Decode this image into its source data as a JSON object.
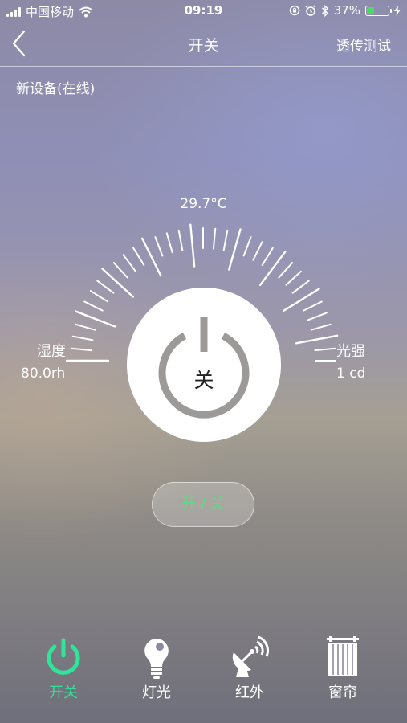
{
  "status_bar": {
    "carrier": "中国移动",
    "time": "09:19",
    "battery_percent": "37%",
    "battery_level": 0.37,
    "icons": [
      "signal-icon",
      "wifi-icon",
      "orientation-lock-icon",
      "alarm-icon",
      "bluetooth-icon",
      "battery-icon",
      "charging-icon"
    ]
  },
  "nav": {
    "back_icon": "chevron-left-icon",
    "title": "开关",
    "right_action": "透传测试"
  },
  "device": {
    "name": "新设备(在线)"
  },
  "gauge": {
    "temperature": "29.7°C",
    "humidity_label": "湿度",
    "humidity_value": "80.0rh",
    "light_label": "光强",
    "light_value": "1 cd"
  },
  "power": {
    "icon": "power-icon",
    "state_text": "关"
  },
  "toggle_button": {
    "label": "开 / 关",
    "color": "#56df7d"
  },
  "tabs": [
    {
      "label": "开关",
      "icon": "power-icon",
      "active": true
    },
    {
      "label": "灯光",
      "icon": "bulb-icon",
      "active": false
    },
    {
      "label": "红外",
      "icon": "satellite-icon",
      "active": false
    },
    {
      "label": "窗帘",
      "icon": "curtain-icon",
      "active": false
    }
  ],
  "colors": {
    "accent": "#2ee59a",
    "battery_fill": "#4cd964"
  }
}
